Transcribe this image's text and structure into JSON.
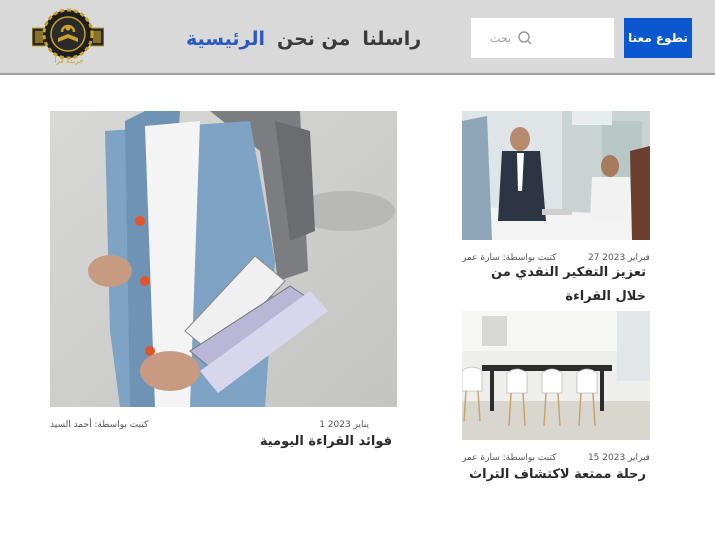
{
  "header": {
    "volunteer_label": "تطوع معنا",
    "search_placeholder": "بحث",
    "nav": [
      "الرئيسية",
      "من نحن",
      "راسلنا"
    ],
    "logo_text": "جريدة قرأ",
    "colors": {
      "accent": "#0b57d0",
      "nav_active": "#2b59c3",
      "header_bg": "#d9d9d9",
      "logo_gold": "#c9a227"
    }
  },
  "featured": {
    "date": "يناير 2023 1",
    "author": "كتبت بواسطة: أحمد السيد",
    "title": "فوائد القراءة اليومية",
    "image_icon": "student-with-books-photo"
  },
  "side_articles": [
    {
      "date": "فبراير 2023 27",
      "author": "كتبت بواسطة: سارة عمر",
      "title": "تعزيز التفكير النقدي من خلال القراءة",
      "image_icon": "office-meeting-photo"
    },
    {
      "date": "فبراير 2023 15",
      "author": "كتبت بواسطة: سارة عمر",
      "title": "رحلة ممتعة لاكتشاف التراث",
      "image_icon": "dining-room-photo"
    }
  ]
}
